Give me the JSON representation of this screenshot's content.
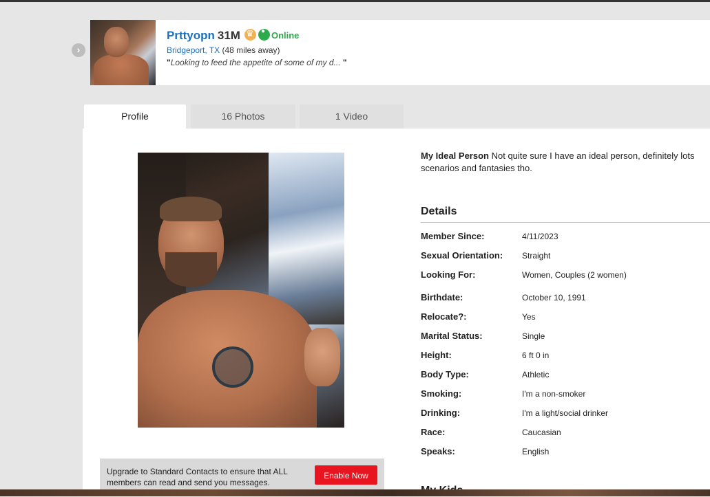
{
  "header": {
    "username": "Prttyopn",
    "age_sex": "31M",
    "status": "Online",
    "location_city": "Bridgeport, TX",
    "distance": "(48 miles away)",
    "quote_open": "\"",
    "tagline": "Looking to feed the appetite of some of my d...",
    "quote_close": "\"",
    "badges": [
      "crown-icon",
      "online-icon"
    ]
  },
  "tabs": [
    {
      "label": "Profile",
      "active": true
    },
    {
      "label": "16 Photos",
      "active": false
    },
    {
      "label": "1 Video",
      "active": false
    }
  ],
  "ideal_person": {
    "heading": "My Ideal Person",
    "text": " Not quite sure I have an ideal person, definitely lots scenarios and fantasies tho."
  },
  "details": {
    "title": "Details",
    "rows": [
      {
        "label": "Member Since:",
        "value": "4/11/2023"
      },
      {
        "label": "Sexual Orientation:",
        "value": "Straight"
      },
      {
        "label": "Looking For:",
        "value": "Women, Couples (2 women)"
      },
      {
        "label": "Birthdate:",
        "value": "October 10, 1991"
      },
      {
        "label": "Relocate?:",
        "value": "Yes"
      },
      {
        "label": "Marital Status:",
        "value": "Single"
      },
      {
        "label": "Height:",
        "value": "6 ft 0 in"
      },
      {
        "label": "Body Type:",
        "value": "Athletic"
      },
      {
        "label": "Smoking:",
        "value": "I'm a non-smoker"
      },
      {
        "label": "Drinking:",
        "value": "I'm a light/social drinker"
      },
      {
        "label": "Race:",
        "value": "Caucasian"
      },
      {
        "label": "Speaks:",
        "value": "English"
      }
    ]
  },
  "next_section_title": "My Kids",
  "upgrade": {
    "text": "Upgrade to Standard Contacts to ensure that ALL members can read and send you messages.",
    "button": "Enable Now"
  },
  "colors": {
    "link": "#1f6fb8",
    "online": "#2eaa4c",
    "crown": "#f3b155",
    "cta": "#e8141f"
  }
}
